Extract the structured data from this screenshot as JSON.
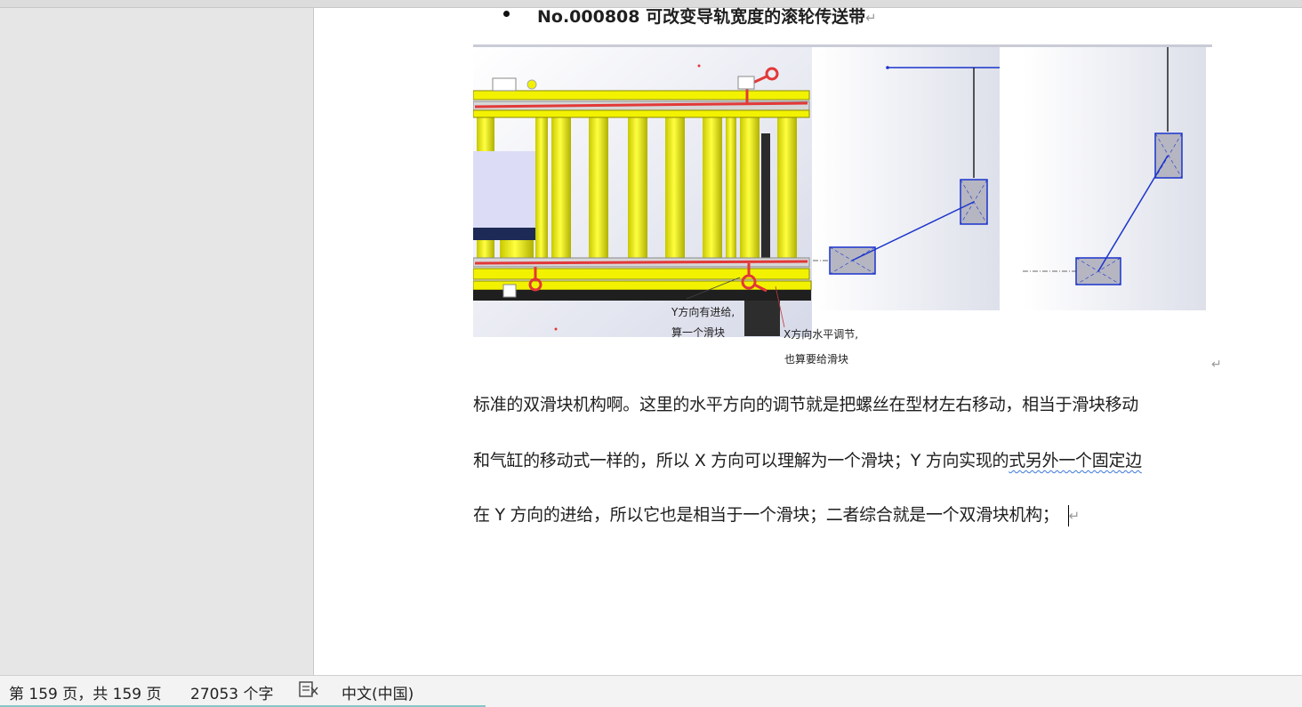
{
  "heading": {
    "number": "No.000808",
    "title": "可改变导轨宽度的滚轮传送带",
    "para_mark": "↵"
  },
  "figure": {
    "label_y": [
      "Y方向有进给,",
      "算一个滑块"
    ],
    "label_x": [
      "X方向水平调节,",
      "也算要给滑块"
    ],
    "para_mark": "↵"
  },
  "body": {
    "line1": "标准的双滑块机构啊。这里的水平方向的调节就是把螺丝在型材左右移动，相当于滑块移动",
    "line2_a": "和气缸的移动式一样的，所以 X 方向可以理解为一个滑块；Y 方向实现的",
    "line2_b": "式另外一个固定边",
    "line3": "在 Y 方向的进给，所以它也是相当于一个滑块；二者综合就是一个双滑块机构；",
    "para_mark": "↵"
  },
  "status": {
    "page": "第 159 页，共 159 页",
    "words": "27053 个字",
    "language": "中文(中国)",
    "proofing_icon": "proofing-icon"
  },
  "colors": {
    "accent": "#87c6c6",
    "rail": "#e23838",
    "roller": "#f2f200",
    "sketch": "#1a33cc"
  }
}
